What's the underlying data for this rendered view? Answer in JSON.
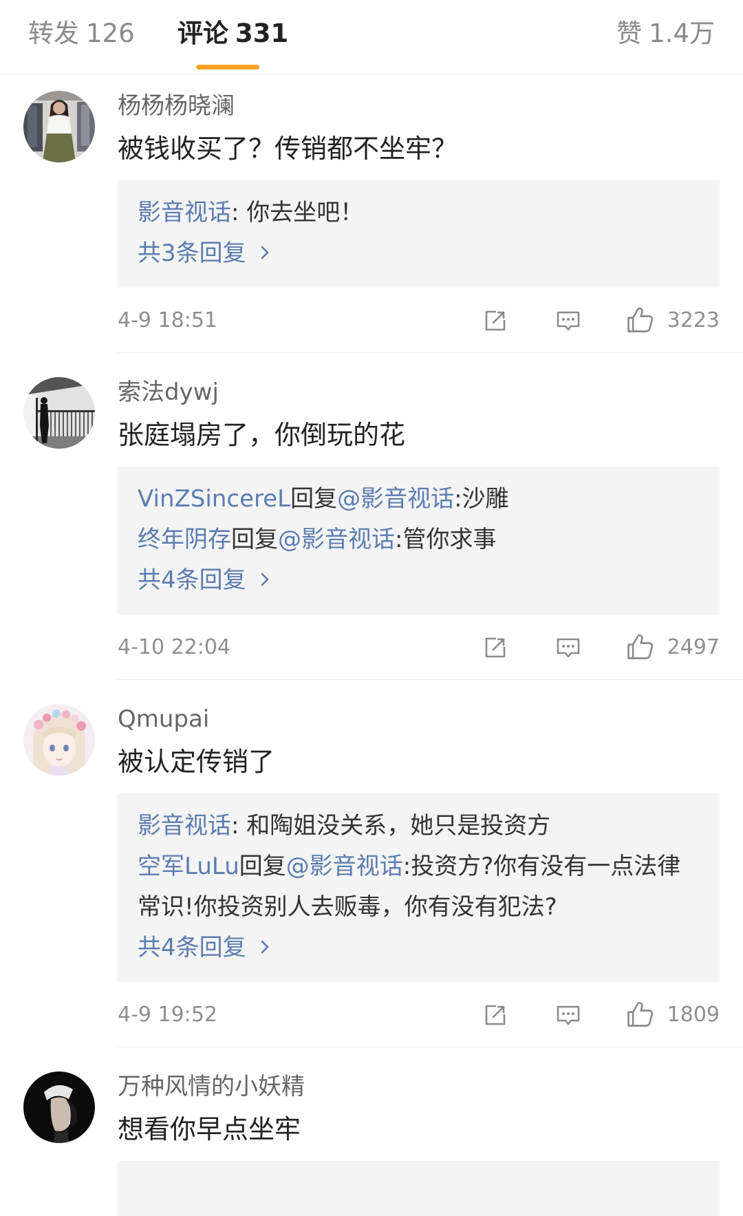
{
  "tabs": [
    {
      "label": "转发",
      "count": "126",
      "active": false
    },
    {
      "label": "评论",
      "count": "331",
      "active": true
    },
    {
      "label": "赞",
      "count": "1.4万",
      "active": false
    }
  ],
  "comments": [
    {
      "username": "杨杨杨晓澜",
      "text": "被钱收买了？传销都不坐牢？",
      "replies": [
        {
          "name": "影音视话",
          "text": ": 你去坐吧！"
        }
      ],
      "more": "共3条回复",
      "time": "4-9 18:51",
      "likes": "3223"
    },
    {
      "username": "索法dywj",
      "text": "张庭塌房了，你倒玩的花",
      "replies": [
        {
          "name": "VinZSincereL",
          "verb": "回复",
          "target": "@影音视话",
          "text": ":沙雕"
        },
        {
          "name": "终年阴存",
          "verb": "回复",
          "target": "@影音视话",
          "text": ":管你求事"
        }
      ],
      "more": "共4条回复",
      "time": "4-10 22:04",
      "likes": "2497"
    },
    {
      "username": "Qmupai",
      "text": "被认定传销了",
      "replies": [
        {
          "name": "影音视话",
          "text": ": 和陶姐没关系，她只是投资方"
        },
        {
          "name": "空军LuLu",
          "verb": "回复",
          "target": "@影音视话",
          "text": ":投资方?你有没有一点法律常识!你投资别人去贩毒，你有没有犯法?"
        }
      ],
      "more": "共4条回复",
      "time": "4-9 19:52",
      "likes": "1809"
    },
    {
      "username": "万种风情的小妖精",
      "text": "想看你早点坐牢"
    }
  ],
  "icons": {
    "share": "share-icon",
    "comment": "comment-icon",
    "like": "thumbs-up-icon",
    "more": "chevron-right-icon"
  },
  "colors": {
    "accent": "#f7a427",
    "link": "#5b7cb0",
    "text": "#222222",
    "muted": "#8f8f8f",
    "reply_bg": "#f4f4f4",
    "divider": "#ececec"
  }
}
